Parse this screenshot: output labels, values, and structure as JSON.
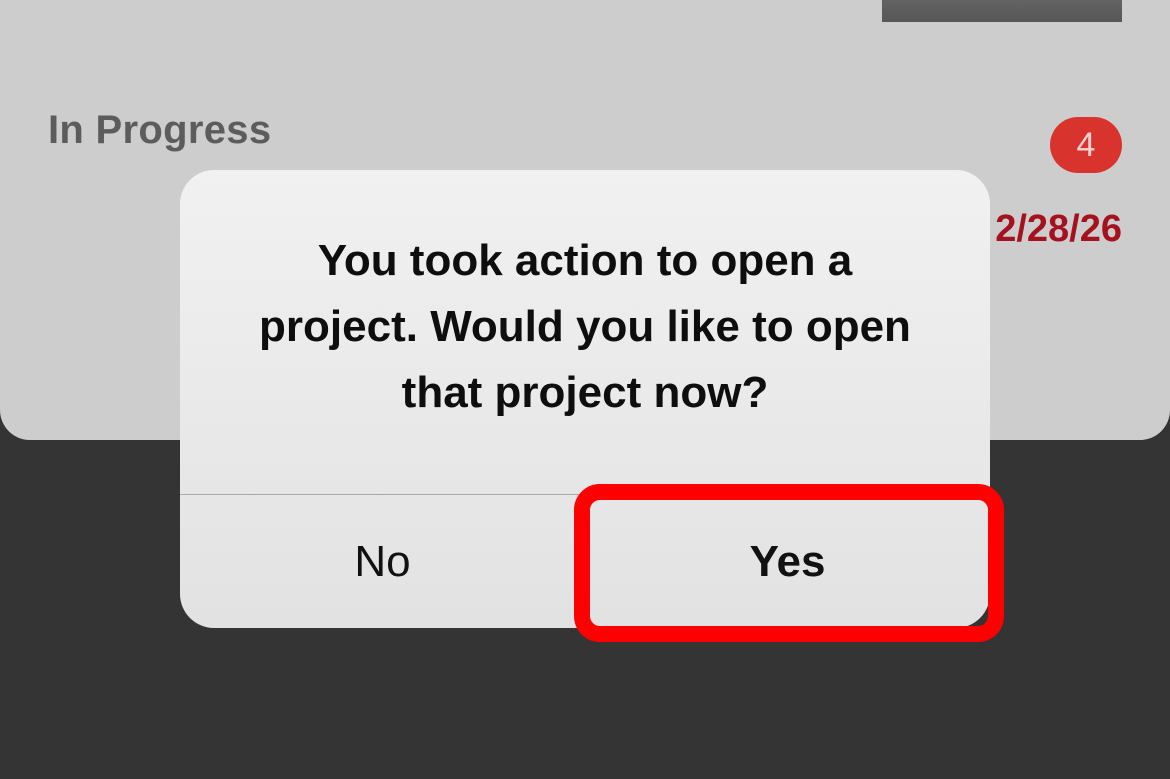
{
  "project_card": {
    "status_label": "In Progress",
    "badge_count": "4",
    "due_date_partial": "2/28/26",
    "colors": {
      "badge": "#d8342d",
      "due_date": "#a3121e"
    }
  },
  "alert": {
    "message": "You took action to open a project. Would you like to open that project now?",
    "buttons": {
      "no_label": "No",
      "yes_label": "Yes"
    }
  },
  "annotation": {
    "highlight_color": "#ff0000",
    "highlighted_target": "yes-button"
  }
}
